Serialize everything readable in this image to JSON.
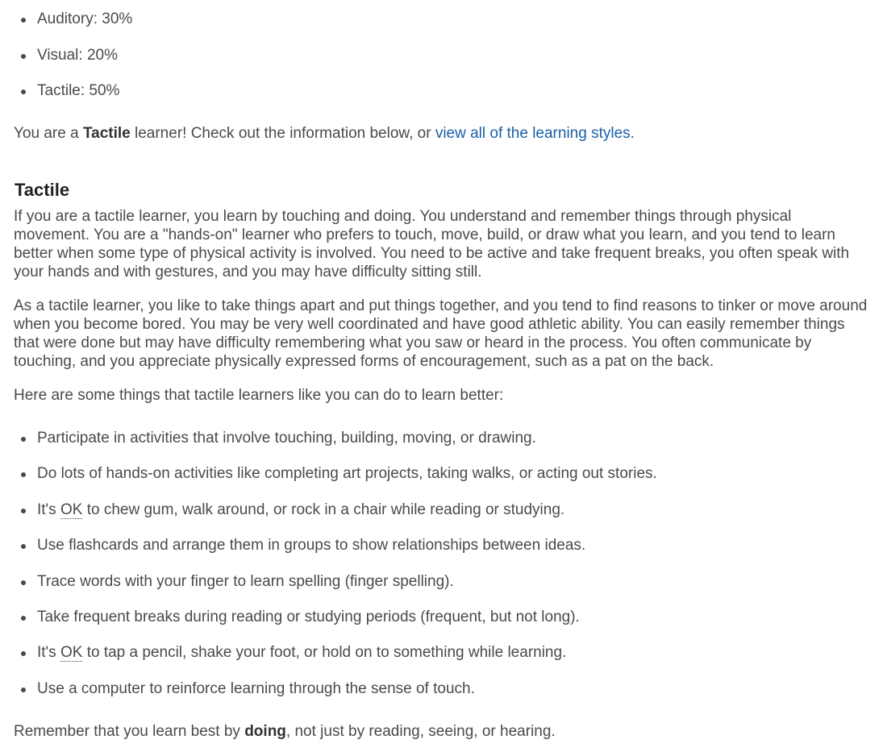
{
  "scores": [
    {
      "label": "Auditory: 30%"
    },
    {
      "label": "Visual: 20%"
    },
    {
      "label": "Tactile: 50%"
    }
  ],
  "result": {
    "prefix": "You are a ",
    "style": "Tactile",
    "middle": " learner! Check out the information below, or ",
    "link_text": "view all of the learning styles",
    "suffix": "."
  },
  "section": {
    "heading": "Tactile",
    "paragraph1": "If you are a tactile learner, you learn by touching and doing. You understand and remember things through physical movement. You are a \"hands-on\" learner who prefers to touch, move, build, or draw what you learn, and you tend to learn better when some type of physical activity is involved. You need to be active and take frequent breaks, you often speak with your hands and with gestures, and you may have difficulty sitting still.",
    "paragraph2": "As a tactile learner, you like to take things apart and put things together, and you tend to find reasons to tinker or move around when you become bored. You may be very well coordinated and have good athletic ability. You can easily remember things that were done but may have difficulty remembering what you saw or heard in the process. You often communicate by touching, and you appreciate physically expressed forms of encouragement, such as a pat on the back.",
    "tips_intro": "Here are some things that tactile learners like you can do to learn better:"
  },
  "tips": {
    "t1": "Participate in activities that involve touching, building, moving, or drawing.",
    "t2": "Do lots of hands-on activities like completing art projects, taking walks, or acting out stories.",
    "t3_prefix": "It's ",
    "t3_abbr": "OK",
    "t3_suffix": " to chew gum, walk around, or rock in a chair while reading or studying.",
    "t4": "Use flashcards and arrange them in groups to show relationships between ideas.",
    "t5": "Trace words with your finger to learn spelling (finger spelling).",
    "t6": "Take frequent breaks during reading or studying periods (frequent, but not long).",
    "t7_prefix": "It's ",
    "t7_abbr": "OK",
    "t7_suffix": " to tap a pencil, shake your foot, or hold on to something while learning.",
    "t8": "Use a computer to reinforce learning through the sense of touch."
  },
  "closing": {
    "prefix": "Remember that you learn best by ",
    "bold": "doing",
    "suffix": ", not just by reading, seeing, or hearing."
  },
  "colors": {
    "text": "#4a4a4a",
    "link": "#1a5fa6",
    "heading": "#222222"
  }
}
